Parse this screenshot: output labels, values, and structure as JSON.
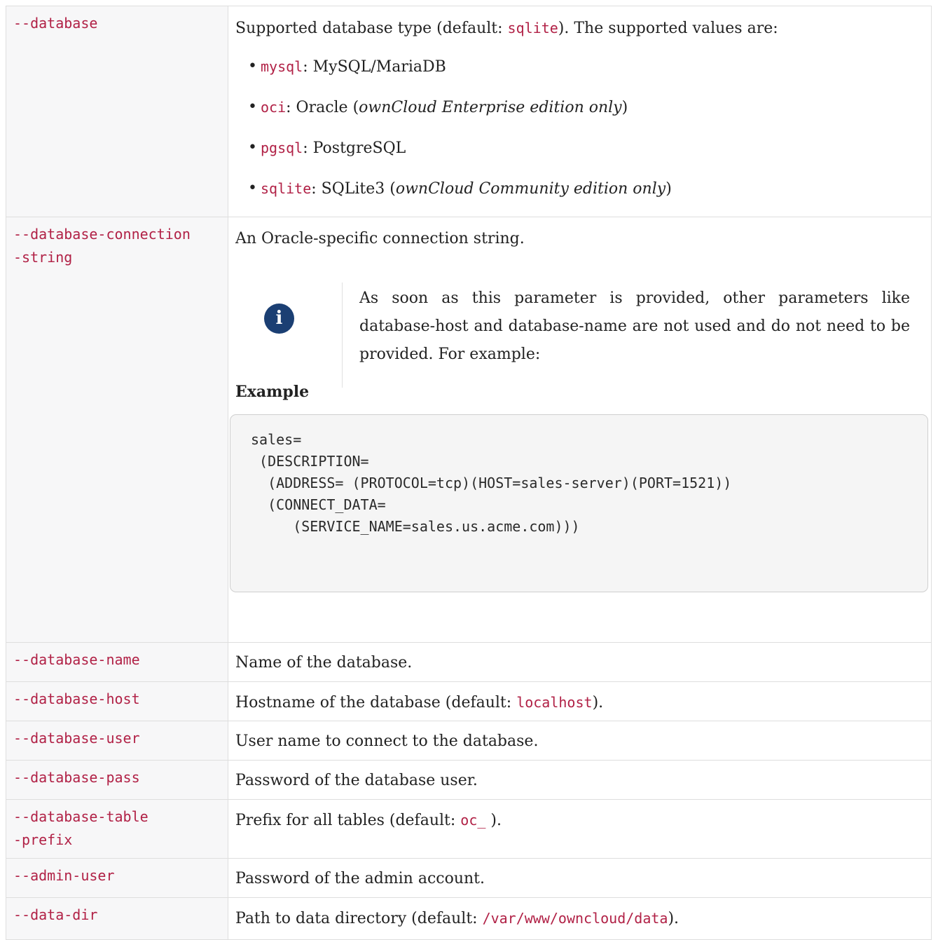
{
  "rows": [
    {
      "option": "--database",
      "desc_before": "Supported database type (default: ",
      "desc_code": "sqlite",
      "desc_after": "). The supported values are:",
      "values": [
        {
          "code": "mysql",
          "sep": ": ",
          "text": "MySQL/MariaDB",
          "em": "",
          "tail": ""
        },
        {
          "code": "oci",
          "sep": ": ",
          "text": "Oracle (",
          "em": "ownCloud Enterprise edition only",
          "tail": ")"
        },
        {
          "code": "pgsql",
          "sep": ": ",
          "text": "PostgreSQL",
          "em": "",
          "tail": ""
        },
        {
          "code": "sqlite",
          "sep": ": ",
          "text": "SQLite3 (",
          "em": "ownCloud Community edition only",
          "tail": ")"
        }
      ]
    },
    {
      "option": "--database-connection\n-string",
      "desc": "An Oracle-specific connection string.",
      "note": "As soon as this parameter is provided, other parameters like database-host and database-name are not used and do not need to be provided. For example:",
      "example_title": "Example",
      "example_code": "sales=\n (DESCRIPTION=\n  (ADDRESS= (PROTOCOL=tcp)(HOST=sales-server)(PORT=1521))\n  (CONNECT_DATA=\n     (SERVICE_NAME=sales.us.acme.com)))"
    },
    {
      "option": "--database-name",
      "desc": "Name of the database."
    },
    {
      "option": "--database-host",
      "desc_before": "Hostname of the database (default: ",
      "desc_code": "localhost",
      "desc_after": ")."
    },
    {
      "option": "--database-user",
      "desc": "User name to connect to the database."
    },
    {
      "option": "--database-pass",
      "desc": "Password of the database user."
    },
    {
      "option": "--database-table\n-prefix",
      "desc_before": "Prefix for all tables (default: ",
      "desc_code": "oc_",
      "desc_after": " )."
    },
    {
      "option": "--admin-user",
      "desc": "Password of the admin account."
    },
    {
      "option": "--data-dir",
      "desc_before": "Path to data directory (default: ",
      "desc_code": "/var/www/owncloud/data",
      "desc_after": ")."
    }
  ],
  "icons": {
    "info": "i"
  }
}
